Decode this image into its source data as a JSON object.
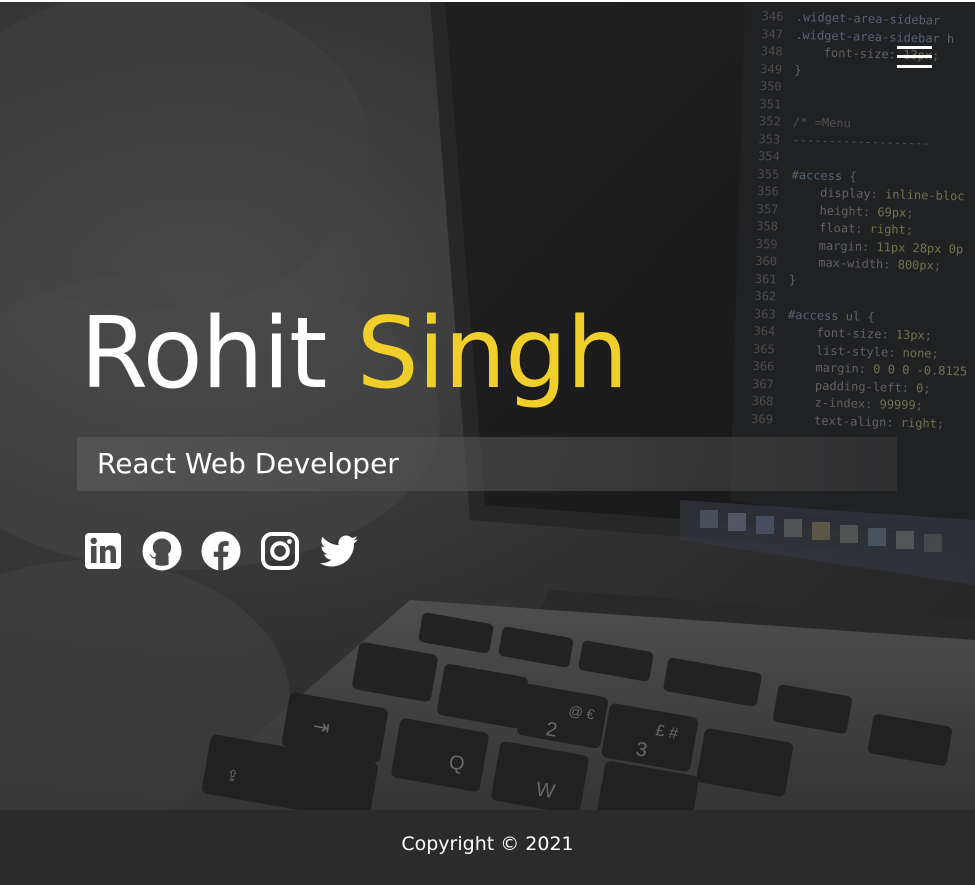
{
  "header": {
    "menu_icon": "hamburger-menu-icon"
  },
  "hero": {
    "first_name": "Rohit",
    "last_name": "Singh",
    "role": "React Web Developer",
    "accent_color": "#f0cf2a",
    "background_image": "laptop-with-code-photo"
  },
  "socials": [
    {
      "name": "LinkedIn",
      "icon": "linkedin-icon"
    },
    {
      "name": "GitHub",
      "icon": "github-icon"
    },
    {
      "name": "Facebook",
      "icon": "facebook-icon"
    },
    {
      "name": "Instagram",
      "icon": "instagram-icon"
    },
    {
      "name": "Twitter",
      "icon": "twitter-icon"
    }
  ],
  "footer": {
    "copyright": "Copyright © 2021",
    "background": "#2b2b2b"
  }
}
